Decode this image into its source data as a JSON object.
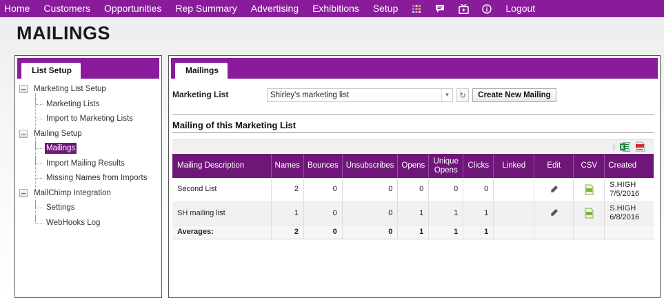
{
  "nav": {
    "items": [
      "Home",
      "Customers",
      "Opportunities",
      "Rep Summary",
      "Advertising",
      "Exhibitions",
      "Setup"
    ],
    "icons": [
      "grid-apps-icon",
      "chat-icon",
      "video-icon",
      "info-icon"
    ],
    "logout": "Logout"
  },
  "page": {
    "title": "MAILINGS"
  },
  "left": {
    "tab": "List Setup",
    "tree": [
      {
        "label": "Marketing List Setup",
        "level": 0
      },
      {
        "label": "Marketing Lists",
        "level": 1
      },
      {
        "label": "Import to Marketing Lists",
        "level": 1
      },
      {
        "label": "Mailing Setup",
        "level": 0
      },
      {
        "label": "Mailings",
        "level": 1,
        "selected": true
      },
      {
        "label": "Import Mailing Results",
        "level": 1
      },
      {
        "label": "Missing Names from Imports",
        "level": 1
      },
      {
        "label": "MailChimp Integration",
        "level": 0
      },
      {
        "label": "Settings",
        "level": 1
      },
      {
        "label": "WebHooks Log",
        "level": 1
      }
    ]
  },
  "main": {
    "tab": "Mailings",
    "marketing_list_label": "Marketing List",
    "marketing_list_value": "Shirley's marketing list",
    "create_button": "Create New Mailing",
    "section_title": "Mailing of this Marketing List",
    "columns": [
      "Mailing Description",
      "Names",
      "Bounces",
      "Unsubscribes",
      "Opens",
      "Unique Opens",
      "Clicks",
      "Linked",
      "Edit",
      "CSV",
      "Created"
    ],
    "rows": [
      {
        "description": "Second List",
        "names": "2",
        "bounces": "0",
        "unsubscribes": "0",
        "opens": "0",
        "unique_opens": "0",
        "clicks": "0",
        "linked": "",
        "created_by": "S.HIGH",
        "created_date": "7/5/2016"
      },
      {
        "description": "SH mailing list",
        "names": "1",
        "bounces": "0",
        "unsubscribes": "0",
        "opens": "1",
        "unique_opens": "1",
        "clicks": "1",
        "linked": "",
        "created_by": "S.HIGH",
        "created_date": "6/8/2016"
      }
    ],
    "averages": {
      "label": "Averages:",
      "names": "2",
      "bounces": "0",
      "unsubscribes": "0",
      "opens": "1",
      "unique_opens": "1",
      "clicks": "1"
    }
  },
  "colors": {
    "brand_purple": "#8a1c9c",
    "header_purple": "#6f1779"
  }
}
